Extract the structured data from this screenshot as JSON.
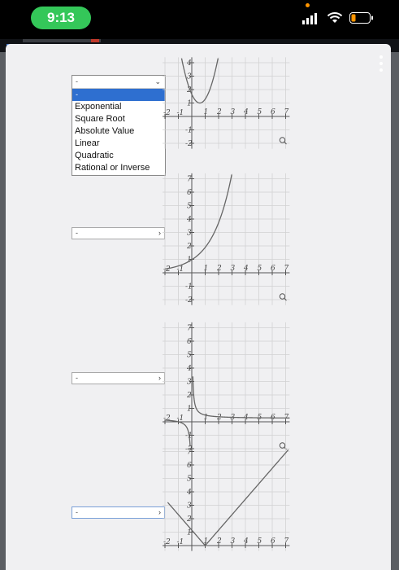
{
  "status_bar": {
    "time": "9:13"
  },
  "dropdowns": [
    {
      "selected": "-",
      "options": [
        "Exponential",
        "Square Root",
        "Absolute Value",
        "Linear",
        "Quadratic",
        "Rational or Inverse"
      ]
    },
    {
      "selected": "-"
    },
    {
      "selected": "-"
    },
    {
      "selected": "-"
    }
  ],
  "graphs": [
    {
      "x_ticks": [
        "-2",
        "-1",
        "1",
        "2",
        "3",
        "4",
        "5",
        "6",
        "7"
      ],
      "y_ticks": [
        "4",
        "3",
        "2",
        "1",
        "-1",
        "-2"
      ]
    },
    {
      "x_ticks": [
        "-2",
        "-1",
        "1",
        "2",
        "3",
        "4",
        "5",
        "6",
        "7"
      ],
      "y_ticks": [
        "7",
        "6",
        "5",
        "4",
        "3",
        "2",
        "1",
        "-1",
        "-2"
      ]
    },
    {
      "x_ticks": [
        "-2",
        "-1",
        "1",
        "2",
        "3",
        "4",
        "5",
        "6",
        "7"
      ],
      "y_ticks": [
        "7",
        "6",
        "5",
        "4",
        "3",
        "2",
        "1",
        "-1",
        "-2"
      ]
    },
    {
      "x_ticks": [
        "-2",
        "-1",
        "1",
        "2",
        "3",
        "4",
        "5",
        "6",
        "7"
      ],
      "y_ticks": [
        "7",
        "6",
        "5",
        "4",
        "3",
        "2",
        "1"
      ]
    }
  ]
}
